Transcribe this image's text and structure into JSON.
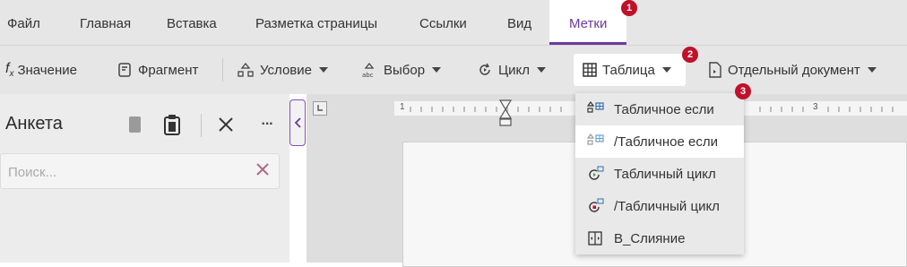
{
  "menubar": {
    "items": [
      "Файл",
      "Главная",
      "Вставка",
      "Разметка страницы",
      "Ссылки",
      "Вид",
      "Метки"
    ],
    "active": "Метки"
  },
  "toolbar": {
    "value": "Значение",
    "fragment": "Фрагмент",
    "condition": "Условие",
    "choice": "Выбор",
    "loop": "Цикл",
    "table": "Таблица",
    "separate_doc": "Отдельный документ"
  },
  "sidebar": {
    "title": "Анкета",
    "search_placeholder": "Поиск...",
    "more": "···"
  },
  "ruler": {
    "labels": [
      "1",
      "3"
    ]
  },
  "table_menu": {
    "items": [
      "Табличное если",
      "/Табличное если",
      "Табличный цикл",
      "/Табличный цикл",
      "В_Слияние"
    ]
  },
  "badges": [
    "1",
    "2",
    "3"
  ],
  "colors": {
    "accent": "#6c3aa0",
    "badge": "#c0102a",
    "hover": "#ffffff"
  }
}
